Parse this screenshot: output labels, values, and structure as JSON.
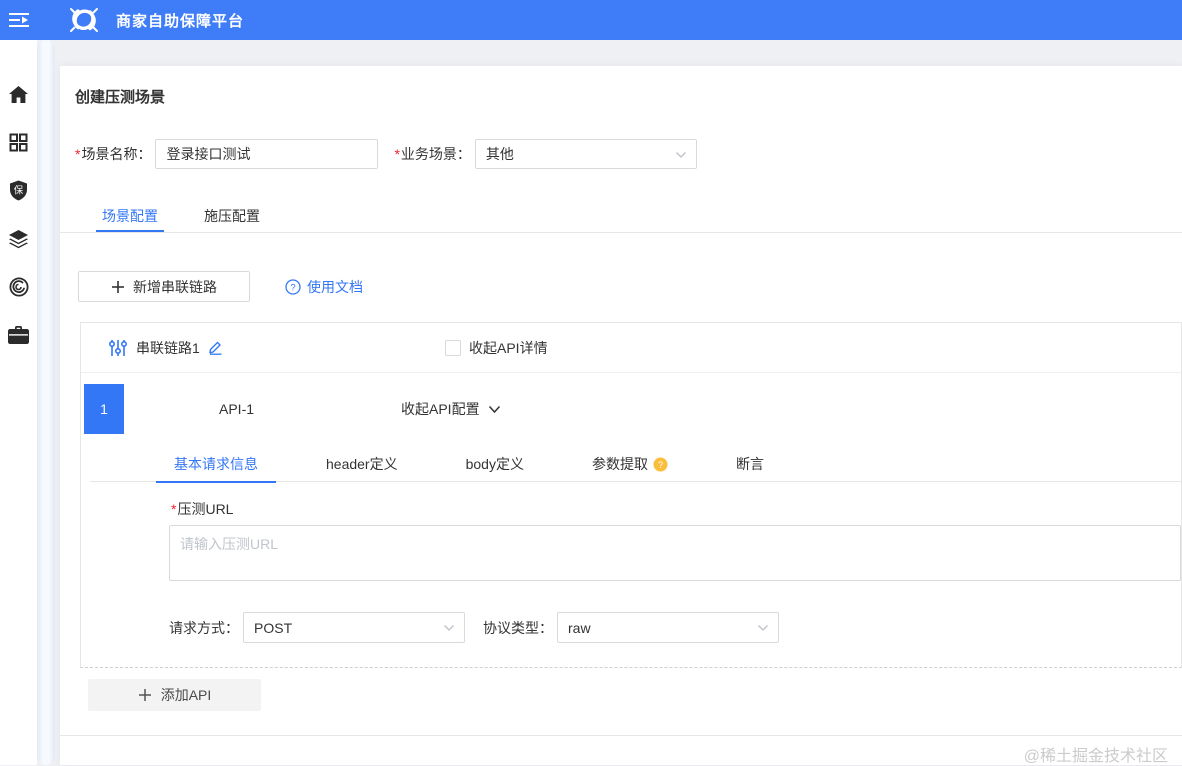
{
  "header": {
    "app_title": "商家自助保障平台"
  },
  "sidebar": {
    "shield_char": "保",
    "items": [
      {
        "icon": "home"
      },
      {
        "icon": "grid"
      },
      {
        "icon": "shield"
      },
      {
        "icon": "layers"
      },
      {
        "icon": "coin"
      },
      {
        "icon": "briefcase"
      }
    ]
  },
  "page": {
    "title": "创建压测场景"
  },
  "ui": {
    "required_mark": "*",
    "question_mark": "?",
    "plus_mark": "+"
  },
  "form": {
    "scenario_name": {
      "label": "场景名称：",
      "value": "登录接口测试"
    },
    "business_scenario": {
      "label": "业务场景：",
      "value": "其他"
    }
  },
  "tabs": [
    {
      "label": "场景配置",
      "active": true
    },
    {
      "label": "施压配置",
      "active": false
    }
  ],
  "toolbar": {
    "add_chain_label": "新增串联链路",
    "docs_label": "使用文档"
  },
  "chain": {
    "title": "串联链路1",
    "collapse_detail_label": "收起API详情",
    "api": {
      "index": "1",
      "name": "API-1",
      "collapse_config_label": "收起API配置",
      "tabs": [
        {
          "label": "基本请求信息",
          "active": true
        },
        {
          "label": "header定义",
          "active": false
        },
        {
          "label": "body定义",
          "active": false
        },
        {
          "label": "参数提取",
          "active": false,
          "help": true
        },
        {
          "label": "断言",
          "active": false
        }
      ],
      "url_field": {
        "label": "压测URL",
        "placeholder": "请输入压测URL"
      },
      "method_field": {
        "label": "请求方式：",
        "value": "POST"
      },
      "protocol_field": {
        "label": "协议类型：",
        "value": "raw"
      }
    },
    "add_api_label": "添加API"
  },
  "watermark": "@稀土掘金技术社区",
  "colors": {
    "header_blue": "#3e7df7",
    "accent_blue": "#3377f6",
    "required_red": "#f5222d",
    "warning_orange": "#fbbd3c"
  }
}
